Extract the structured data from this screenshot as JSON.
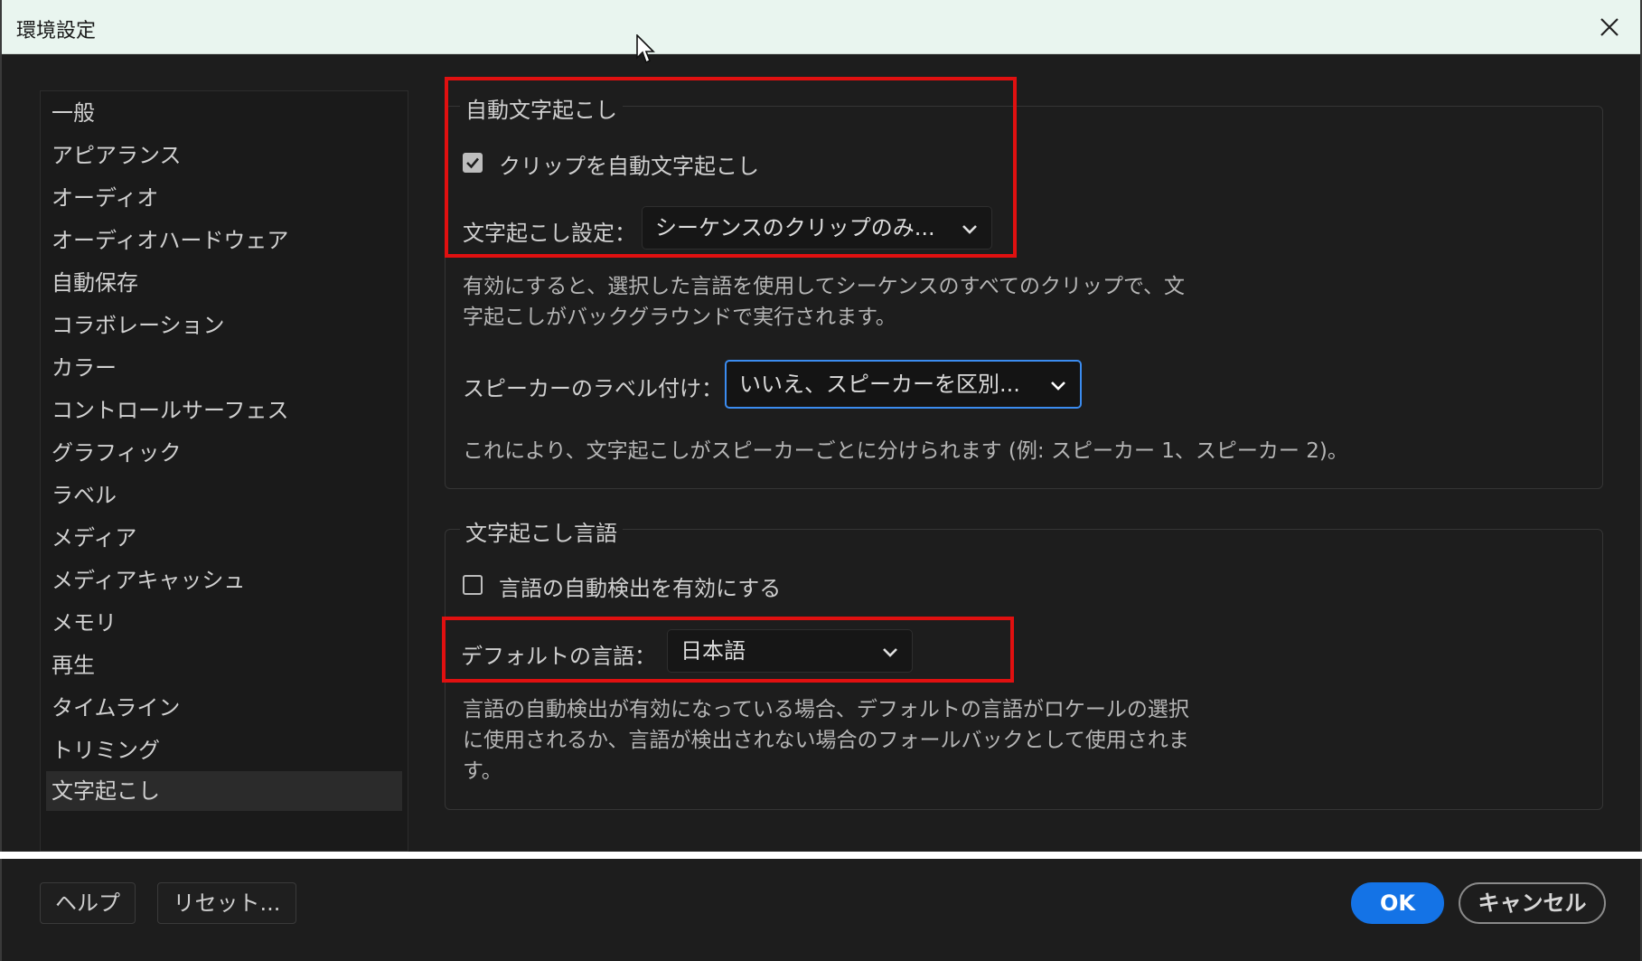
{
  "window": {
    "title": "環境設定"
  },
  "sidebar": {
    "items": [
      {
        "label": "一般"
      },
      {
        "label": "アピアランス"
      },
      {
        "label": "オーディオ"
      },
      {
        "label": "オーディオハードウェア"
      },
      {
        "label": "自動保存"
      },
      {
        "label": "コラボレーション"
      },
      {
        "label": "カラー"
      },
      {
        "label": "コントロールサーフェス"
      },
      {
        "label": "グラフィック"
      },
      {
        "label": "ラベル"
      },
      {
        "label": "メディア"
      },
      {
        "label": "メディアキャッシュ"
      },
      {
        "label": "メモリ"
      },
      {
        "label": "再生"
      },
      {
        "label": "タイムライン"
      },
      {
        "label": "トリミング"
      },
      {
        "label": "文字起こし",
        "selected": true
      }
    ]
  },
  "auto_transcription": {
    "group_title": "自動文字起こし",
    "checkbox_label": "クリップを自動文字起こし",
    "checked": true,
    "setting_label": "文字起こし設定：",
    "setting_value": "シーケンスのクリップのみ...",
    "description_line1": "有効にすると、選択した言語を使用してシーケンスのすべてのクリップで、文",
    "description_line2": "字起こしがバックグラウンドで実行されます。",
    "speaker_label": "スピーカーのラベル付け：",
    "speaker_value": "いいえ、スピーカーを区別...",
    "speaker_description": "これにより、文字起こしがスピーカーごとに分けられます (例: スピーカー 1、スピーカー 2)。"
  },
  "transcription_language": {
    "group_title": "文字起こし言語",
    "checkbox_label": "言語の自動検出を有効にする",
    "checked": false,
    "default_label": "デフォルトの言語：",
    "default_value": "日本語",
    "description_line1": "言語の自動検出が有効になっている場合、デフォルトの言語がロケールの選択",
    "description_line2": "に使用されるか、言語が検出されない場合のフォールバックとして使用されま",
    "description_line3": "す。"
  },
  "footer": {
    "help_label": "ヘルプ",
    "reset_label": "リセット...",
    "ok_label": "OK",
    "cancel_label": "キャンセル"
  },
  "colors": {
    "accent": "#1473e6",
    "focus_ring": "#3b8cf0",
    "annotation": "#e01010",
    "background": "#1d1d1d"
  }
}
